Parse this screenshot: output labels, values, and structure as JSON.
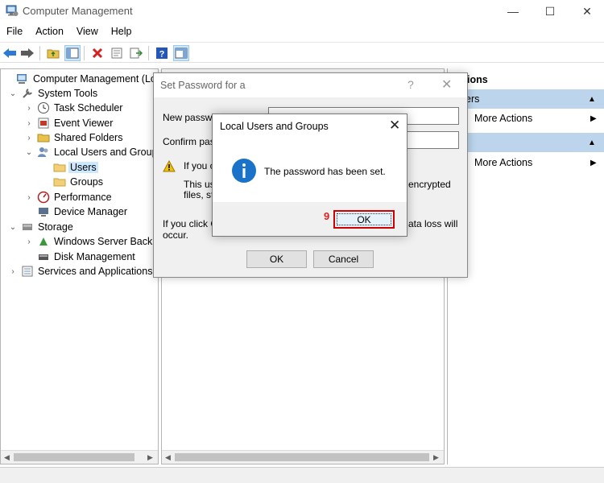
{
  "window": {
    "title": "Computer Management",
    "minimize": "—",
    "maximize": "☐",
    "close": "✕"
  },
  "menu": [
    "File",
    "Action",
    "View",
    "Help"
  ],
  "tree": {
    "root": "Computer Management (Loca",
    "system_tools": "System Tools",
    "task_scheduler": "Task Scheduler",
    "event_viewer": "Event Viewer",
    "shared_folders": "Shared Folders",
    "local_users": "Local Users and Group",
    "users": "Users",
    "groups": "Groups",
    "performance": "Performance",
    "device_manager": "Device Manager",
    "storage": "Storage",
    "windows_server_backup": "Windows Server Backu",
    "disk_management": "Disk Management",
    "services_apps": "Services and Applications"
  },
  "actions": {
    "header": "ions",
    "section1": "ers",
    "more1": "More Actions",
    "more2": "More Actions"
  },
  "set_password": {
    "title": "Set Password for a",
    "help": "?",
    "close": "✕",
    "new_label": "New passwo",
    "confirm_label": "Confirm pass",
    "warn_line1": "If you c",
    "desc_line1": "This use",
    "desc_line1_end": "encrypted",
    "desc_line2": "files, sto",
    "dataloss_line1": "If you click C",
    "dataloss_line1_end": "ata loss will",
    "dataloss_line2": "occur.",
    "ok": "OK",
    "cancel": "Cancel"
  },
  "message_box": {
    "title": "Local Users and Groups",
    "close": "✕",
    "text": "The password has been set.",
    "step": "9",
    "ok": "OK"
  },
  "colors": {
    "selection": "#cce8ff",
    "actions_section": "#bcd4ec",
    "highlight": "#d00000",
    "info_icon": "#1a73c8"
  }
}
